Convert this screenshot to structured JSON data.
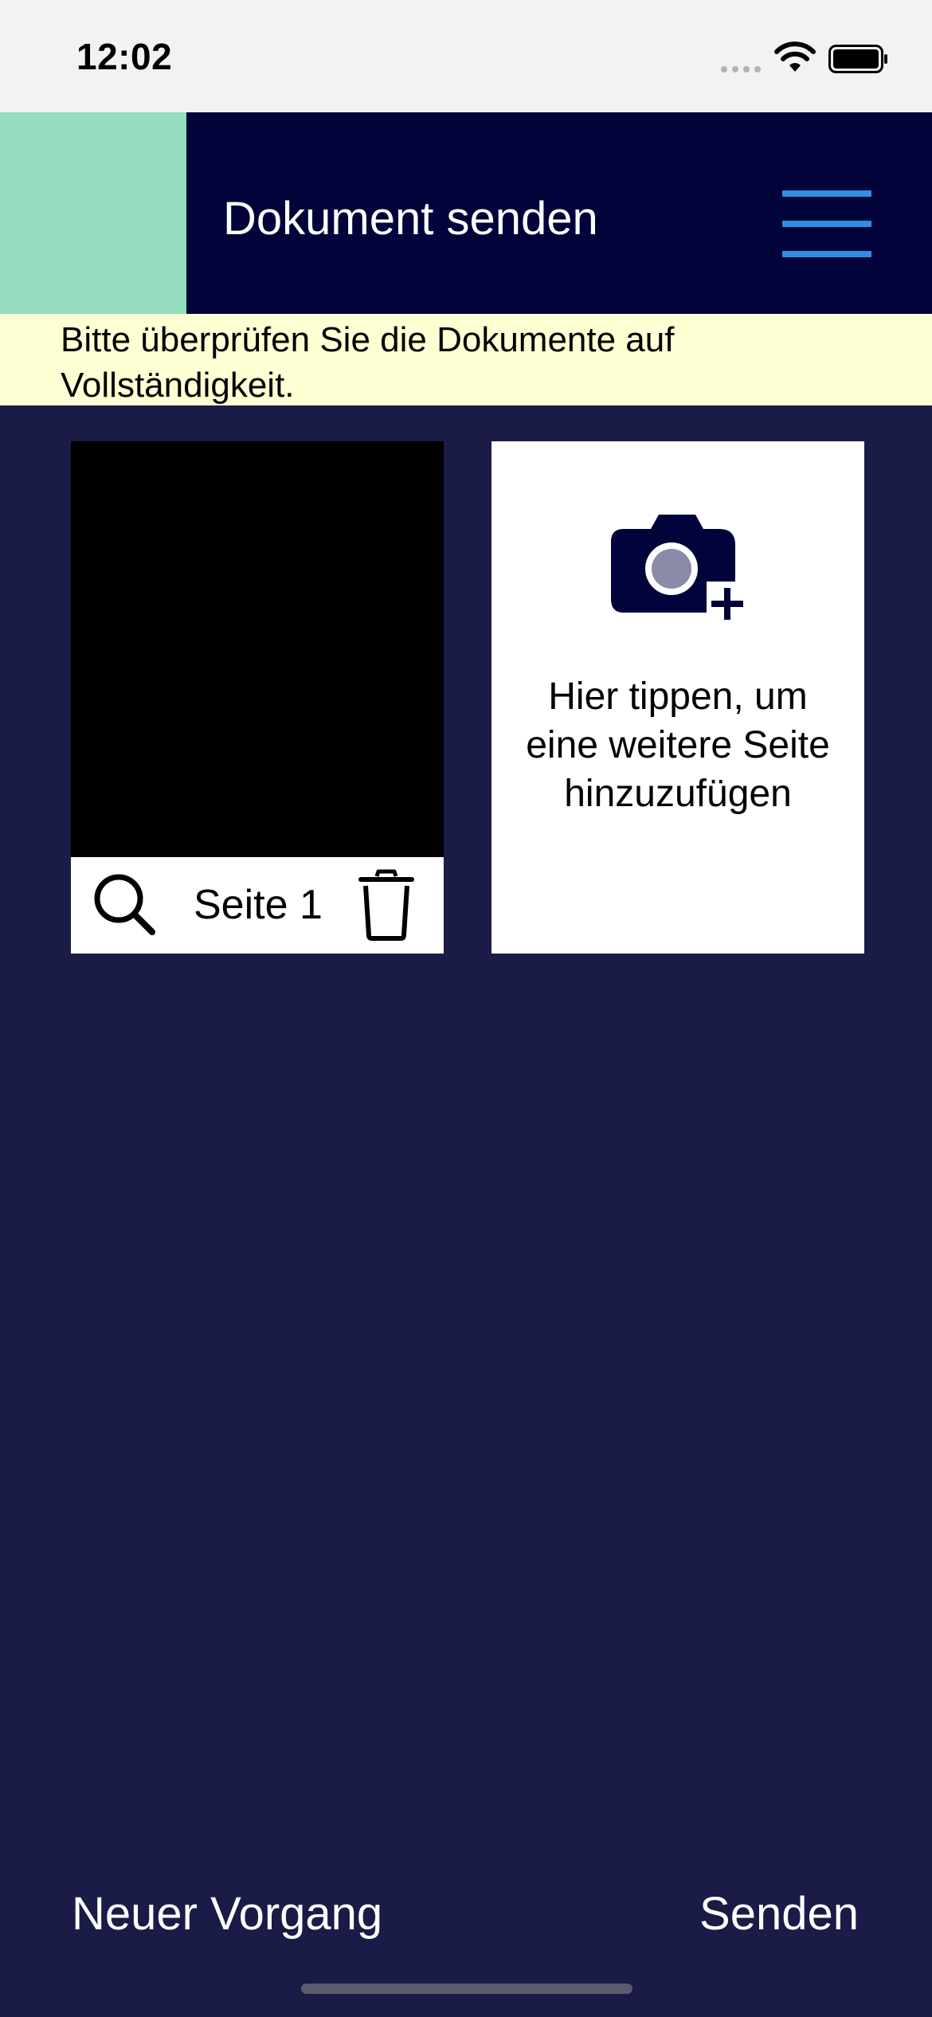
{
  "status_bar": {
    "time": "12:02"
  },
  "header": {
    "title": "Dokument senden",
    "menu_icon": "hamburger-menu-icon",
    "accent_color": "#93dcbd",
    "background_color": "#02033a",
    "menu_color": "#2f8fe0"
  },
  "notice": {
    "text": "Bitte überprüfen Sie die Dokumente auf Vollständigkeit.",
    "background_color": "#ffffd4"
  },
  "pages": [
    {
      "label": "Seite 1",
      "zoom_icon": "magnifier-icon",
      "delete_icon": "trash-icon"
    }
  ],
  "add_page": {
    "icon": "camera-plus-icon",
    "text": "Hier tippen, um eine weitere Seite hinzuzufügen"
  },
  "footer": {
    "new_process": "Neuer Vorgang",
    "send": "Senden"
  },
  "colors": {
    "page_background": "#1a1b47"
  }
}
